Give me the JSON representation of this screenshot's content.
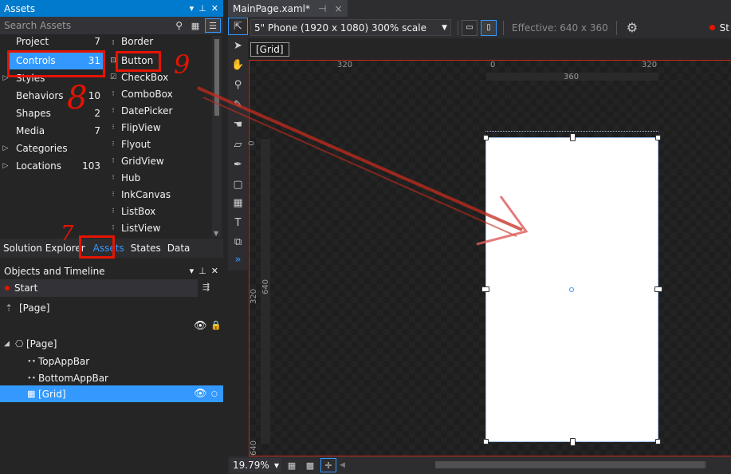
{
  "assets_panel": {
    "title": "Assets",
    "search_placeholder": "Search Assets",
    "categories": [
      {
        "label": "Project",
        "count": "7"
      },
      {
        "label": "Controls",
        "count": "31"
      },
      {
        "label": "Styles",
        "count": ""
      },
      {
        "label": "Behaviors",
        "count": "10"
      },
      {
        "label": "Shapes",
        "count": "2"
      },
      {
        "label": "Media",
        "count": "7"
      },
      {
        "label": "Categories",
        "count": ""
      },
      {
        "label": "Locations",
        "count": "103"
      }
    ],
    "controls": [
      "Border",
      "Button",
      "CheckBox",
      "ComboBox",
      "DatePicker",
      "FlipView",
      "Flyout",
      "GridView",
      "Hub",
      "InkCanvas",
      "ListBox",
      "ListView"
    ]
  },
  "bottom_tabs": [
    "Solution Explorer",
    "Assets",
    "States",
    "Data"
  ],
  "objects_panel": {
    "title": "Objects and Timeline",
    "storyboard": "Start",
    "root": "[Page]",
    "tree": [
      "[Page]",
      "TopAppBar",
      "BottomAppBar",
      "[Grid]"
    ]
  },
  "designer": {
    "doc_tab": "MainPage.xaml*",
    "pin_glyph": "⊣",
    "close_glyph": "×",
    "device": "5\" Phone (1920 x 1080) 300% scale",
    "effective": "Effective: 640 x 360",
    "status_partial": "St",
    "breadcrumb": "[Grid]",
    "ruler_top": [
      "320",
      "0",
      "320"
    ],
    "ruler_width_label": "360",
    "ruler_left": [
      "0",
      "320",
      "640"
    ],
    "ruler_height_label": "640",
    "zoom": "19.79%"
  },
  "annotations": {
    "num7": "7",
    "num8": "8",
    "num9": "9"
  }
}
